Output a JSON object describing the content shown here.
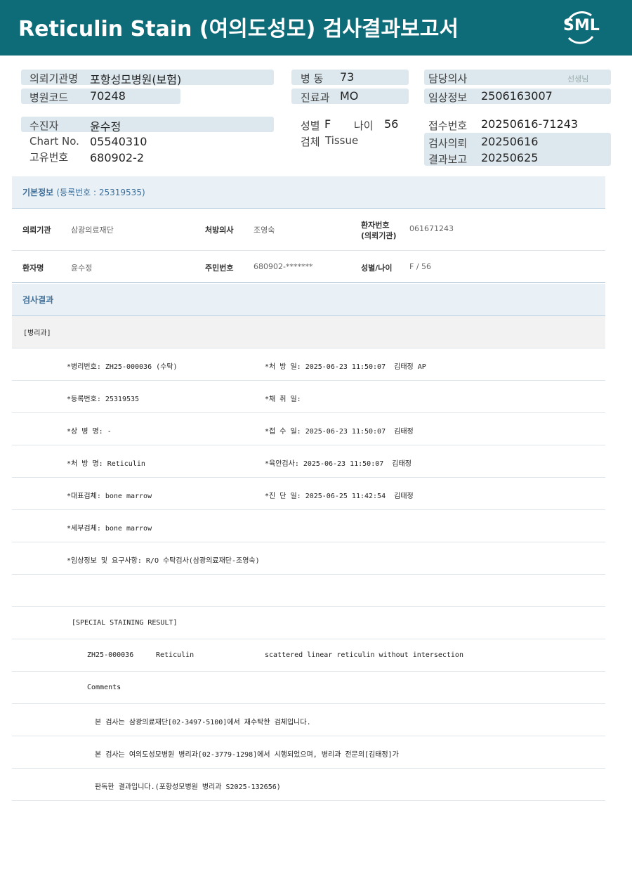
{
  "header": {
    "title": "Reticulin Stain (여의도성모) 검사결과보고서",
    "logo_text": "SML"
  },
  "info": {
    "institution_label": "의뢰기관명",
    "institution": "포항성모병원(보험)",
    "hospital_code_label": "병원코드",
    "hospital_code": "70248",
    "ward_label": "병 동",
    "ward": "73",
    "dept_label": "진료과",
    "dept": "MO",
    "doctor_label": "담당의사",
    "doctor_suffix": "선생님",
    "clinical_label": "임상정보",
    "clinical": "2506163007",
    "patient_label": "수진자",
    "patient": "윤수정",
    "chart_label": "Chart No.",
    "chart": "05540310",
    "uid_label": "고유번호",
    "uid": "680902-2",
    "sex_label": "성별",
    "sex": "F",
    "age_label": "나이",
    "age": "56",
    "specimen_label": "검체",
    "specimen": "Tissue",
    "receipt_label": "접수번호",
    "receipt": "20250616-71243",
    "request_label": "검사의뢰",
    "request": "20250616",
    "report_label": "결과보고",
    "report": "20250625"
  },
  "basic": {
    "title": "기본정보",
    "subtitle": "(등록번호 : 25319535)",
    "inst_label": "의뢰기관",
    "inst": "삼광의료재단",
    "prescriber_label": "처방의사",
    "prescriber": "조영숙",
    "pid_label": "환자번호",
    "pid_label2": "(의뢰기관)",
    "pid": "061671243",
    "name_label": "환자명",
    "name": "윤수정",
    "rrn_label": "주민번호",
    "rrn": "680902-*******",
    "sexage_label": "성별/나이",
    "sexage": "F / 56"
  },
  "result": {
    "title": "검사결과",
    "dept": "[병리과]",
    "lines": [
      {
        "left": "*병리번호: ZH25-000036 (수탁)",
        "right": "*처 방 일: 2025-06-23 11:50:07  김태정 AP"
      },
      {
        "left": "*등록번호: 25319535",
        "right": "*채 취 일:"
      },
      {
        "left": "*상 병 명: -",
        "right": "*접 수 일: 2025-06-23 11:50:07  김태정"
      },
      {
        "left": "*처 방 명: Reticulin",
        "right": "*육안검사: 2025-06-23 11:50:07  김태정"
      },
      {
        "left": "*대표검체: bone marrow",
        "right": "*진 단 일: 2025-06-25 11:42:54  김태정"
      },
      {
        "left": "*세부검체: bone marrow",
        "right": ""
      },
      {
        "left": "*임상정보 및 요구사항: R/O 수탁검사(삼광의료재단-조영숙)",
        "right": ""
      }
    ],
    "staining_header": "[SPECIAL STAINING RESULT]",
    "staining_id": "ZH25-000036",
    "staining_name": "Reticulin",
    "staining_result": "scattered linear reticulin without intersection",
    "comments_label": "Comments",
    "comment1": "본 검사는 삼광의료재단[02-3497-5100]에서 재수탁한 검체입니다.",
    "comment2": "본 검사는 여의도성모병원 병리과[02-3779-1298]에서 시행되었으며, 병리과 전문의[김태정]가",
    "comment3": "판독한 결과입니다.(포항성모병원 병리과 S2025-132656)"
  }
}
